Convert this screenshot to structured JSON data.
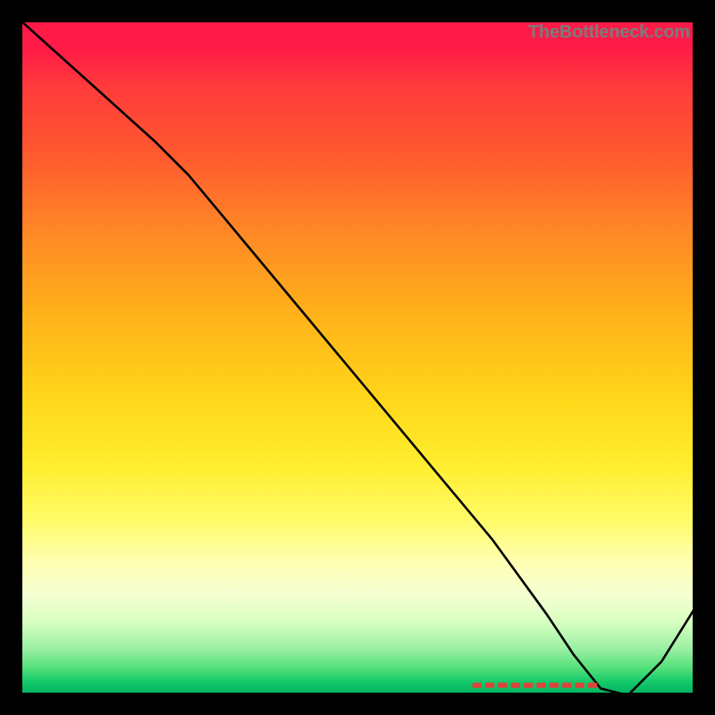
{
  "watermark": "TheBottleneck.com",
  "chart_data": {
    "type": "line",
    "title": "",
    "xlabel": "",
    "ylabel": "",
    "xlim": [
      0,
      100
    ],
    "ylim": [
      0,
      100
    ],
    "grid": false,
    "series": [
      {
        "name": "curve",
        "x": [
          0,
          10,
          20,
          25,
          30,
          40,
          50,
          60,
          70,
          78,
          82,
          86,
          90,
          95,
          100
        ],
        "y": [
          100,
          91,
          82,
          77,
          71,
          59,
          47,
          35,
          23,
          12,
          6,
          1,
          0,
          5,
          13
        ]
      }
    ],
    "annotation": {
      "text_segment": {
        "x_start": 67,
        "x_end": 86,
        "y": 1.5,
        "color": "#d9463c"
      }
    },
    "background_gradient": {
      "orientation": "vertical",
      "stops": [
        {
          "pos": 0.0,
          "color": "#ff1a48"
        },
        {
          "pos": 0.2,
          "color": "#ff5a2f"
        },
        {
          "pos": 0.44,
          "color": "#ffb31a"
        },
        {
          "pos": 0.66,
          "color": "#ffee2f"
        },
        {
          "pos": 0.85,
          "color": "#f6ffd2"
        },
        {
          "pos": 1.0,
          "color": "#00b060"
        }
      ]
    }
  }
}
